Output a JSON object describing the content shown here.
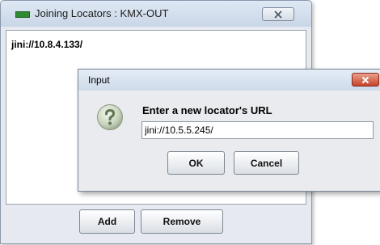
{
  "outer_window": {
    "title": "Joining Locators : KMX-OUT",
    "locators": [
      "jini://10.8.4.133/"
    ],
    "add_label": "Add",
    "remove_label": "Remove"
  },
  "dialog": {
    "title": "Input",
    "prompt": "Enter a new locator's URL",
    "input_value": "jini://10.5.5.245/",
    "ok_label": "OK",
    "cancel_label": "Cancel"
  },
  "icons": {
    "app": "status-led-icon",
    "close": "close-icon",
    "question": "question-icon"
  },
  "colors": {
    "status_led": "#2f8b2f",
    "dialog_close": "#c6442a"
  }
}
